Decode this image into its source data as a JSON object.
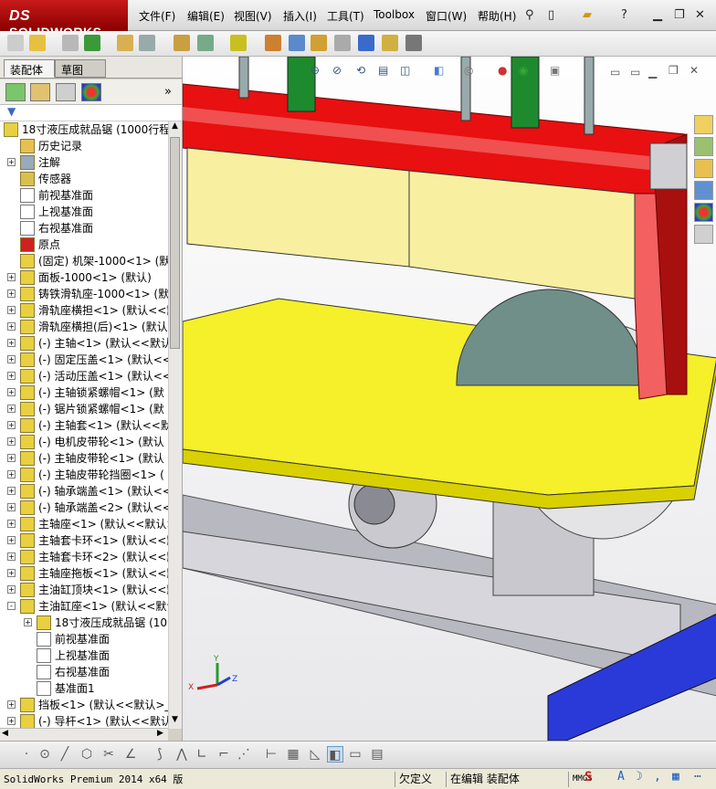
{
  "app": {
    "brand": "SOLIDWORKS",
    "brand_prefix": "DS"
  },
  "menu": [
    "文件(F)",
    "编辑(E)",
    "视图(V)",
    "插入(I)",
    "工具(T)",
    "Toolbox",
    "窗口(W)",
    "帮助(H)"
  ],
  "fm_tabs": {
    "assembly": "装配体",
    "layout": "草图"
  },
  "tree": {
    "root": "18寸液压成就品锯 (1000行程",
    "items": [
      {
        "label": "历史记录",
        "exp": "",
        "indent": 1
      },
      {
        "label": "注解",
        "exp": "+",
        "indent": 1
      },
      {
        "label": "传感器",
        "exp": "",
        "indent": 1
      },
      {
        "label": "前视基准面",
        "exp": "",
        "indent": 1
      },
      {
        "label": "上视基准面",
        "exp": "",
        "indent": 1
      },
      {
        "label": "右视基准面",
        "exp": "",
        "indent": 1
      },
      {
        "label": "原点",
        "exp": "",
        "indent": 1
      },
      {
        "label": "(固定) 机架-1000<1> (默",
        "exp": "",
        "indent": 1
      },
      {
        "label": "面板-1000<1> (默认)",
        "exp": "+",
        "indent": 1
      },
      {
        "label": "铸铁滑轨座-1000<1> (默认",
        "exp": "+",
        "indent": 1
      },
      {
        "label": "滑轨座横担<1> (默认<<默",
        "exp": "+",
        "indent": 1
      },
      {
        "label": "滑轨座横担(后)<1> (默认",
        "exp": "+",
        "indent": 1
      },
      {
        "label": "(-) 主轴<1> (默认<<默认",
        "exp": "+",
        "indent": 1
      },
      {
        "label": "(-) 固定压盖<1> (默认<<",
        "exp": "+",
        "indent": 1
      },
      {
        "label": "(-) 活动压盖<1> (默认<<",
        "exp": "+",
        "indent": 1
      },
      {
        "label": "(-) 主轴锁紧螺帽<1> (默",
        "exp": "+",
        "indent": 1
      },
      {
        "label": "(-) 锯片锁紧螺帽<1> (默",
        "exp": "+",
        "indent": 1
      },
      {
        "label": "(-) 主轴套<1> (默认<<默",
        "exp": "+",
        "indent": 1
      },
      {
        "label": "(-) 电机皮带轮<1> (默认",
        "exp": "+",
        "indent": 1
      },
      {
        "label": "(-) 主轴皮带轮<1> (默认",
        "exp": "+",
        "indent": 1
      },
      {
        "label": "(-) 主轴皮带轮挡圈<1> (",
        "exp": "+",
        "indent": 1
      },
      {
        "label": "(-) 轴承端盖<1> (默认<<",
        "exp": "+",
        "indent": 1
      },
      {
        "label": "(-) 轴承端盖<2> (默认<<",
        "exp": "+",
        "indent": 1
      },
      {
        "label": "主轴座<1> (默认<<默认>_",
        "exp": "+",
        "indent": 1
      },
      {
        "label": "主轴套卡环<1> (默认<<默",
        "exp": "+",
        "indent": 1
      },
      {
        "label": "主轴套卡环<2> (默认<<默",
        "exp": "+",
        "indent": 1
      },
      {
        "label": "主轴座拖板<1> (默认<<默",
        "exp": "+",
        "indent": 1
      },
      {
        "label": "主油缸顶块<1> (默认<<默",
        "exp": "+",
        "indent": 1
      },
      {
        "label": "主油缸座<1> (默认<<默认",
        "exp": "-",
        "indent": 1
      },
      {
        "label": "18寸液压成就品锯 (10",
        "exp": "+",
        "indent": 2
      },
      {
        "label": "前视基准面",
        "exp": "",
        "indent": 2
      },
      {
        "label": "上视基准面",
        "exp": "",
        "indent": 2
      },
      {
        "label": "右视基准面",
        "exp": "",
        "indent": 2
      },
      {
        "label": "基准面1",
        "exp": "",
        "indent": 2
      },
      {
        "label": "挡板<1> (默认<<默认>_显",
        "exp": "+",
        "indent": 1
      },
      {
        "label": "(-) 导杆<1> (默认<<默认",
        "exp": "+",
        "indent": 1
      }
    ]
  },
  "triad": {
    "x": "X",
    "y": "Y",
    "z": "Z"
  },
  "status": {
    "product": "SolidWorks Premium 2014 x64 版",
    "underdefined": "欠定义",
    "editing": "在编辑 装配体",
    "units": "MMGS"
  },
  "colors": {
    "red": "#e81010",
    "yellow": "#f5f02a",
    "blue": "#2a3ad8",
    "gray": "#9a9aa2"
  }
}
